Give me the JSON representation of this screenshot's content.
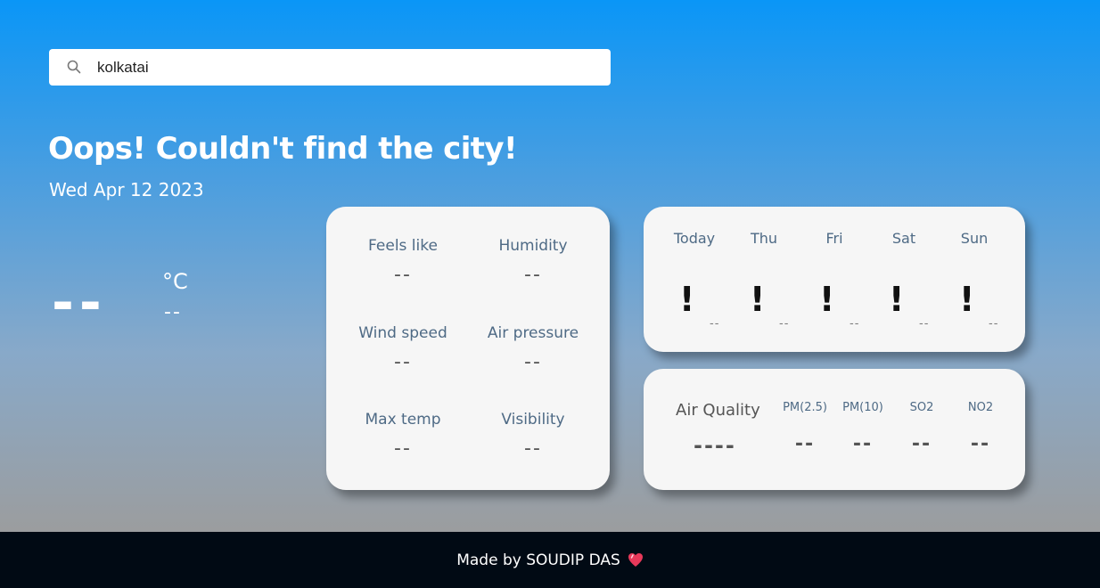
{
  "search": {
    "value": "kolkatai"
  },
  "header": {
    "title": "Oops! Couldn't find the city!",
    "date": "Wed Apr 12 2023"
  },
  "current": {
    "temp": "--",
    "unit": "°C",
    "condition": "--"
  },
  "details": [
    {
      "label": "Feels like",
      "value": "--"
    },
    {
      "label": "Humidity",
      "value": "--"
    },
    {
      "label": "Wind speed",
      "value": "--"
    },
    {
      "label": "Air pressure",
      "value": "--"
    },
    {
      "label": "Max temp",
      "value": "--"
    },
    {
      "label": "Visibility",
      "value": "--"
    }
  ],
  "forecast": [
    {
      "day": "Today",
      "icon": "!",
      "temp": "--"
    },
    {
      "day": "Thu",
      "icon": "!",
      "temp": "--"
    },
    {
      "day": "Fri",
      "icon": "!",
      "temp": "--"
    },
    {
      "day": "Sat",
      "icon": "!",
      "temp": "--"
    },
    {
      "day": "Sun",
      "icon": "!",
      "temp": "--"
    }
  ],
  "air_quality": {
    "title": "Air Quality",
    "value": "----",
    "items": [
      {
        "label": "PM(2.5)",
        "value": "--"
      },
      {
        "label": "PM(10)",
        "value": "--"
      },
      {
        "label": "SO2",
        "value": "--"
      },
      {
        "label": "NO2",
        "value": "--"
      }
    ]
  },
  "footer": {
    "text": "Made by SOUDIP DAS",
    "icon": "heart-icon"
  },
  "colors": {
    "accent": "#0a96f7",
    "footer_bg": "#010a14",
    "card_bg": "#f6f6f6",
    "label": "#4e6a85"
  }
}
